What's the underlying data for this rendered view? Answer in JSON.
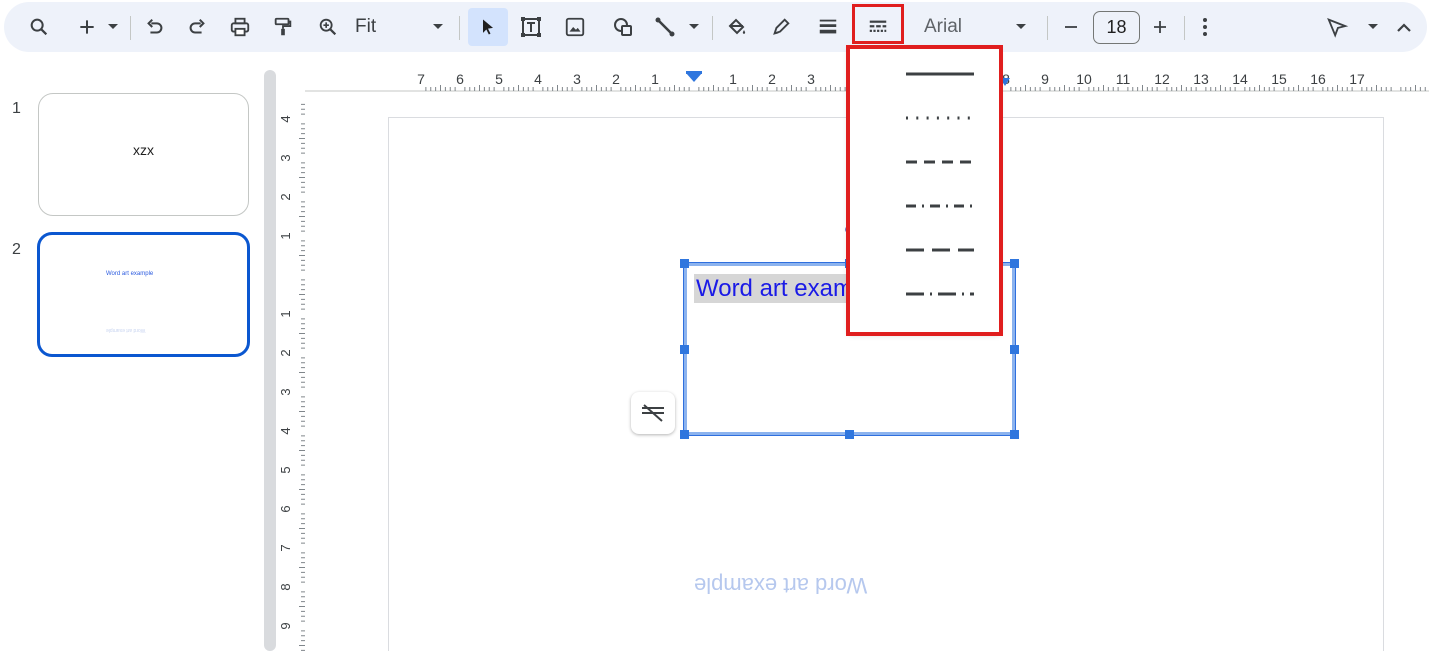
{
  "toolbar": {
    "zoom_label": "Fit",
    "font_label": "Arial",
    "font_size": "18",
    "buttons": [
      "search",
      "new",
      "undo",
      "redo",
      "print",
      "paint-format",
      "zoom",
      "select",
      "text-box",
      "image",
      "shape",
      "line",
      "fill-color",
      "border-color",
      "border-weight",
      "border-dash",
      "decrease-font-size",
      "increase-font-size",
      "more-options",
      "pen-tool",
      "collapse-toolbar"
    ]
  },
  "filmstrip": {
    "slides": [
      {
        "number": "1",
        "text": "xzx"
      },
      {
        "number": "2",
        "text": "Word art example",
        "reflection": "Word art example"
      }
    ]
  },
  "ruler": {
    "horizontal_ticks": [
      "7",
      "6",
      "5",
      "4",
      "3",
      "2",
      "1",
      "1",
      "2",
      "3",
      "8",
      "9",
      "10",
      "11",
      "12",
      "13",
      "14",
      "15",
      "16",
      "17"
    ],
    "vertical_ticks": [
      "4",
      "3",
      "2",
      "1",
      "1",
      "2",
      "3",
      "4",
      "5",
      "6",
      "7",
      "8",
      "9"
    ]
  },
  "canvas": {
    "wordart_text": "Word art example",
    "reflection_text": "Word art example"
  },
  "dash_menu": {
    "options": [
      "solid",
      "dotted",
      "dashed",
      "dash-dot",
      "long-dash",
      "long-dash-dot"
    ]
  },
  "colors": {
    "accent": "#2f76de",
    "highlight": "#e01e1e",
    "wordart_text": "#1a1ae6",
    "toolbar_bg": "#eef2fa"
  }
}
